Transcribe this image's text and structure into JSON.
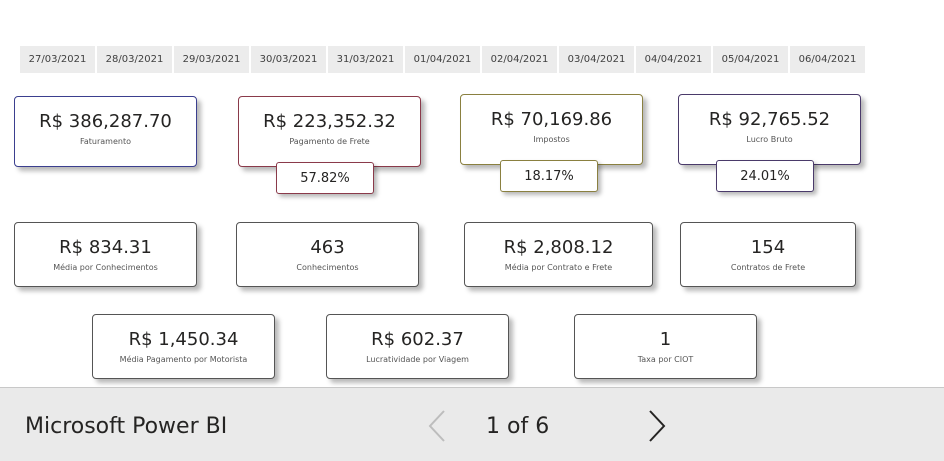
{
  "date_slicer": {
    "dates": [
      "27/03/2021",
      "28/03/2021",
      "29/03/2021",
      "30/03/2021",
      "31/03/2021",
      "01/04/2021",
      "02/04/2021",
      "03/04/2021",
      "04/04/2021",
      "05/04/2021",
      "06/04/2021"
    ]
  },
  "kpis": {
    "faturamento": {
      "value": "R$ 386,287.70",
      "label": "Faturamento",
      "border_color": "#3b3f8f"
    },
    "pagamento_frete": {
      "value": "R$ 223,352.32",
      "label": "Pagamento de Frete",
      "percent": "57.82%",
      "border_color": "#8a3a4a"
    },
    "impostos": {
      "value": "R$ 70,169.86",
      "label": "Impostos",
      "percent": "18.17%",
      "border_color": "#8a8040"
    },
    "lucro_bruto": {
      "value": "R$ 92,765.52",
      "label": "Lucro Bruto",
      "percent": "24.01%",
      "border_color": "#4a3a6a"
    },
    "media_conhecimentos": {
      "value": "R$ 834.31",
      "label": "Média por Conhecimentos"
    },
    "conhecimentos": {
      "value": "463",
      "label": "Conhecimentos"
    },
    "media_contrato_frete": {
      "value": "R$ 2,808.12",
      "label": "Média por Contrato e Frete"
    },
    "contratos_frete": {
      "value": "154",
      "label": "Contratos de Frete"
    },
    "media_pagamento_motorista": {
      "value": "R$ 1,450.34",
      "label": "Média Pagamento por Motorista"
    },
    "lucratividade_viagem": {
      "value": "R$ 602.37",
      "label": "Lucratividade por Viagem"
    },
    "taxa_ciot": {
      "value": "1",
      "label": "Taxa por CIOT"
    }
  },
  "footer": {
    "brand": "Microsoft Power BI",
    "page_indicator": "1 of 6",
    "prev_icon": "chevron-left-icon",
    "next_icon": "chevron-right-icon",
    "prev_disabled": true
  }
}
